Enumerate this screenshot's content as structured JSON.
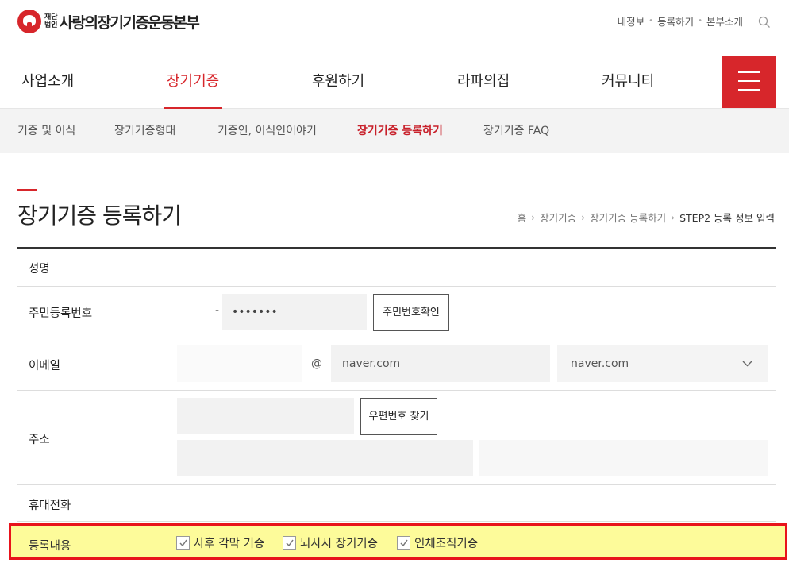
{
  "header": {
    "logo_sub_line1": "재단",
    "logo_sub_line2": "법인",
    "logo_text": "사랑의장기기증운동본부",
    "util_links": [
      "내정보",
      "등록하기",
      "본부소개"
    ],
    "search_icon": "search-icon"
  },
  "gnb": {
    "items": [
      "사업소개",
      "장기기증",
      "후원하기",
      "라파의집",
      "커뮤니티"
    ],
    "active": "장기기증",
    "menu_icon": "hamburger-icon"
  },
  "subnav": {
    "items": [
      "기증 및 이식",
      "장기기증형태",
      "기증인, 이식인이야기",
      "장기기증 등록하기",
      "장기기증 FAQ"
    ],
    "active": "장기기증 등록하기"
  },
  "page": {
    "title": "장기기증 등록하기",
    "breadcrumb": [
      "홈",
      "장기기증",
      "장기기증 등록하기",
      "STEP2 등록 정보 입력"
    ]
  },
  "form": {
    "name_label": "성명",
    "rrn_label": "주민등록번호",
    "rrn_dash": "-",
    "rrn_back_value": "•••••••",
    "rrn_check_button": "주민번호확인",
    "email_label": "이메일",
    "email_at": "@",
    "email_domain_value": "naver.com",
    "email_select_value": "naver.com",
    "address_label": "주소",
    "zip_button": "우편번호 찾기",
    "phone_label": "휴대전화",
    "registration_label": "등록내용",
    "registration_options": [
      "사후 각막 기증",
      "뇌사시 장기기증",
      "인체조직기증"
    ]
  },
  "colors": {
    "brand_red": "#d7262b",
    "highlight_yellow": "#fdfb9a",
    "highlight_border": "#e8131b"
  }
}
